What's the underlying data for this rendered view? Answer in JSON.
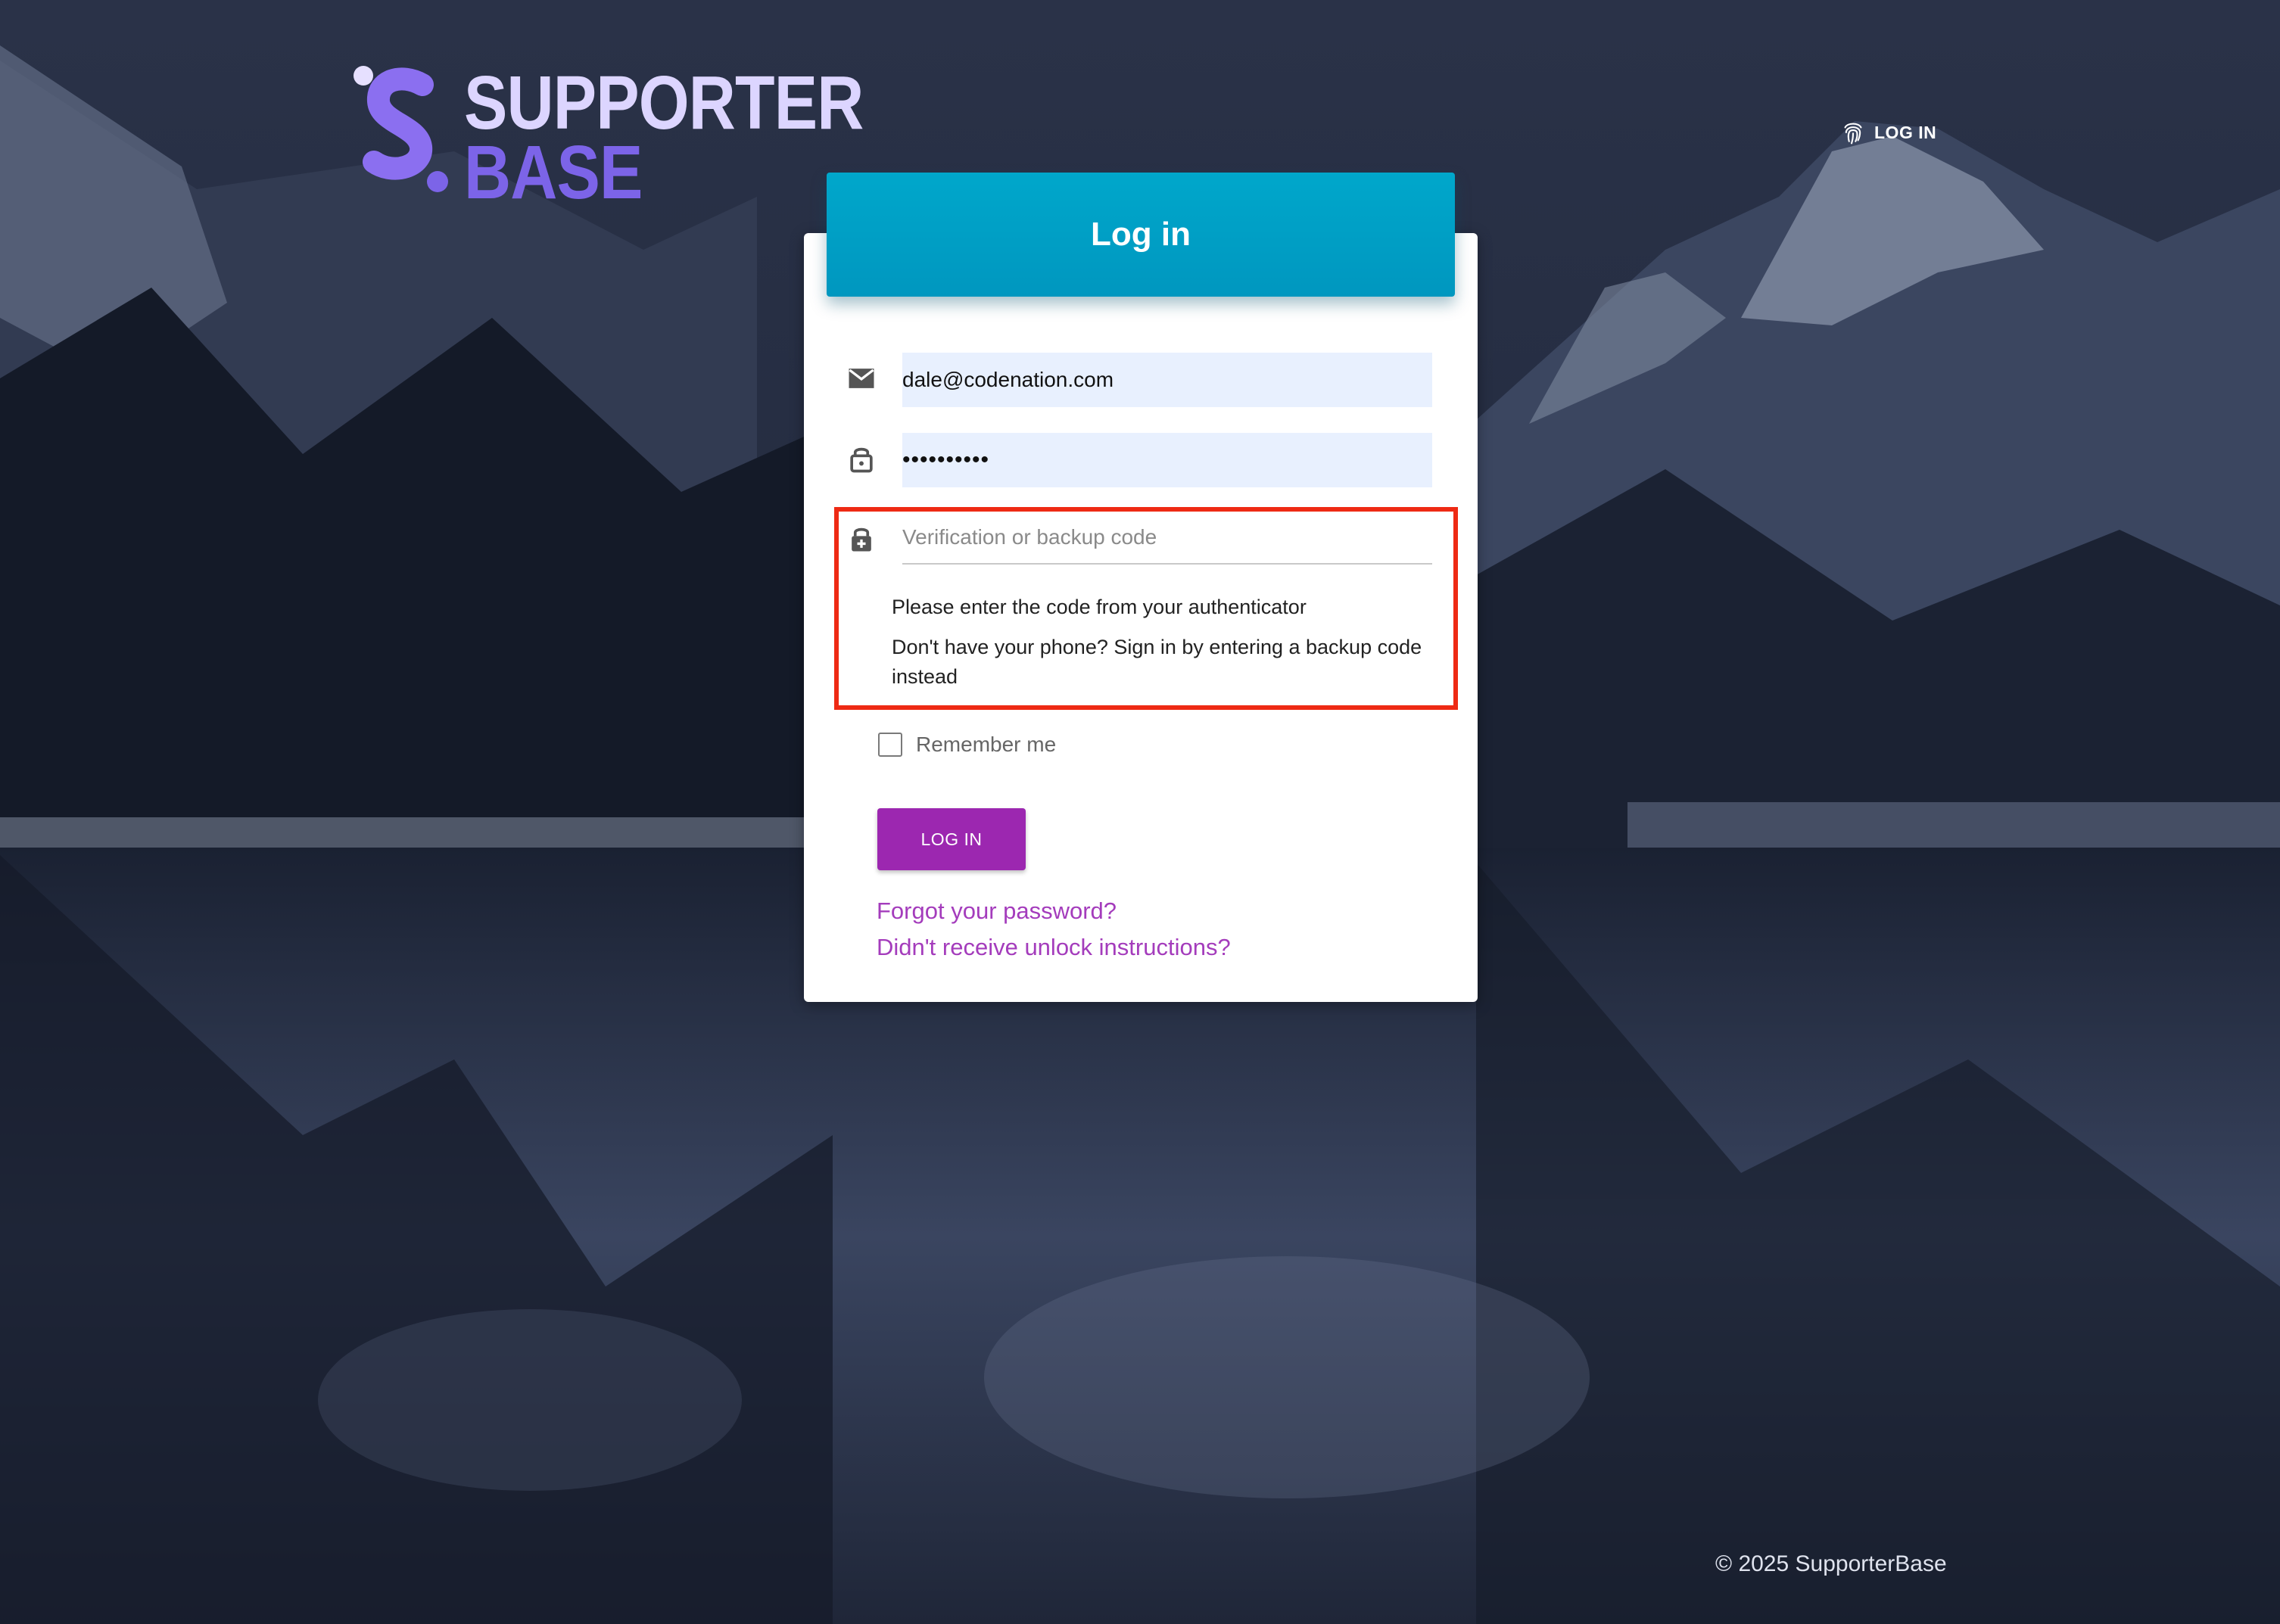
{
  "brand": {
    "line1": "SUPPORTER",
    "line2": "BASE",
    "logo_icon": "supporterbase-logo-icon"
  },
  "header": {
    "top_login_label": "LOG IN",
    "top_login_icon": "fingerprint-icon"
  },
  "form": {
    "title": "Log in",
    "email_value": "dale@codenation.com",
    "email_icon": "mail-icon",
    "password_value": "••••••••••",
    "password_icon": "lock-icon",
    "code_placeholder": "Verification or backup code",
    "code_icon": "lock-plus-icon",
    "hint_authenticator": "Please enter the code from your authenticator",
    "hint_backup": "Don't have your phone? Sign in by entering a backup code instead",
    "remember_label": "Remember me",
    "remember_checked": false,
    "submit_label": "LOG IN",
    "forgot_link": "Forgot your password?",
    "unlock_link": "Didn't receive unlock instructions?"
  },
  "footer": {
    "copyright": "© 2025 SupporterBase"
  },
  "colors": {
    "header_accent": "#00a0c6",
    "button": "#9c27b0",
    "link": "#a43cbc",
    "highlight": "#ee2a14",
    "autofill": "#e8f0fe"
  }
}
